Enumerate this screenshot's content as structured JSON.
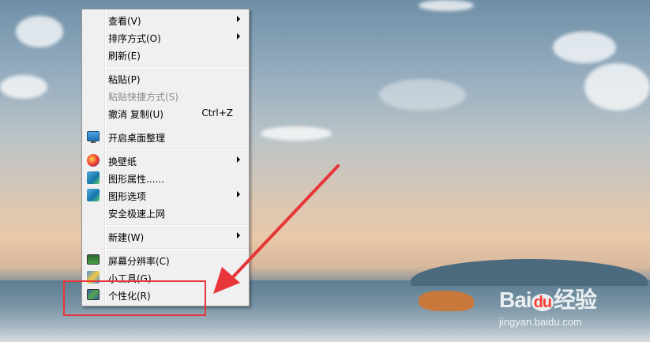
{
  "menu": {
    "items": [
      {
        "label": "查看(V)",
        "submenu": true
      },
      {
        "label": "排序方式(O)",
        "submenu": true
      },
      {
        "label": "刷新(E)"
      },
      {
        "label": "粘贴(P)"
      },
      {
        "label": "粘贴快捷方式(S)",
        "disabled": true
      },
      {
        "label": "撤消 复制(U)",
        "shortcut": "Ctrl+Z"
      },
      {
        "label": "开启桌面整理",
        "icon": "desktop-organize-icon"
      },
      {
        "label": "换壁纸",
        "icon": "wallpaper-icon",
        "submenu": true
      },
      {
        "label": "图形属性......",
        "icon": "graphics-properties-icon"
      },
      {
        "label": "图形选项",
        "icon": "graphics-options-icon",
        "submenu": true
      },
      {
        "label": "安全极速上网"
      },
      {
        "label": "新建(W)",
        "submenu": true
      },
      {
        "label": "屏幕分辨率(C)",
        "icon": "screen-resolution-icon"
      },
      {
        "label": "小工具(G)",
        "icon": "gadgets-icon"
      },
      {
        "label": "个性化(R)",
        "icon": "personalize-icon"
      }
    ]
  },
  "watermark": {
    "brand_a": "Bai",
    "brand_du": "du",
    "brand_cn": "经验",
    "url": "jingyan.baidu.com"
  },
  "colors": {
    "annotation": "#e8353a",
    "menu_bg": "#f0f0f0"
  }
}
